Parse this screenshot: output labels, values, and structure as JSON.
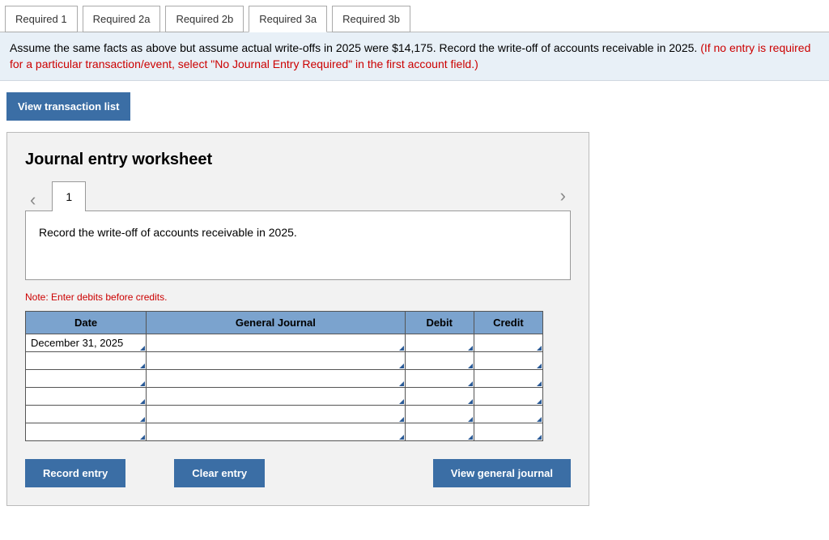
{
  "tabs": [
    {
      "label": "Required 1",
      "active": false
    },
    {
      "label": "Required 2a",
      "active": false
    },
    {
      "label": "Required 2b",
      "active": false
    },
    {
      "label": "Required 3a",
      "active": true
    },
    {
      "label": "Required 3b",
      "active": false
    }
  ],
  "banner": {
    "black": "Assume the same facts as above but assume actual write-offs in 2025 were $14,175. Record the write-off of accounts receivable in 2025. ",
    "red": "(If no entry is required for a particular transaction/event, select \"No Journal Entry Required\" in the first account field.)"
  },
  "view_transaction_list": "View transaction list",
  "worksheet": {
    "title": "Journal entry worksheet",
    "page_number": "1",
    "prompt": "Record the write-off of accounts receivable in 2025.",
    "note": "Note: Enter debits before credits.",
    "headers": {
      "date": "Date",
      "general_journal": "General Journal",
      "debit": "Debit",
      "credit": "Credit"
    },
    "rows": [
      {
        "date": "December 31, 2025",
        "gj": "",
        "debit": "",
        "credit": ""
      },
      {
        "date": "",
        "gj": "",
        "debit": "",
        "credit": ""
      },
      {
        "date": "",
        "gj": "",
        "debit": "",
        "credit": ""
      },
      {
        "date": "",
        "gj": "",
        "debit": "",
        "credit": ""
      },
      {
        "date": "",
        "gj": "",
        "debit": "",
        "credit": ""
      },
      {
        "date": "",
        "gj": "",
        "debit": "",
        "credit": ""
      }
    ],
    "buttons": {
      "record": "Record entry",
      "clear": "Clear entry",
      "view_gj": "View general journal"
    }
  }
}
